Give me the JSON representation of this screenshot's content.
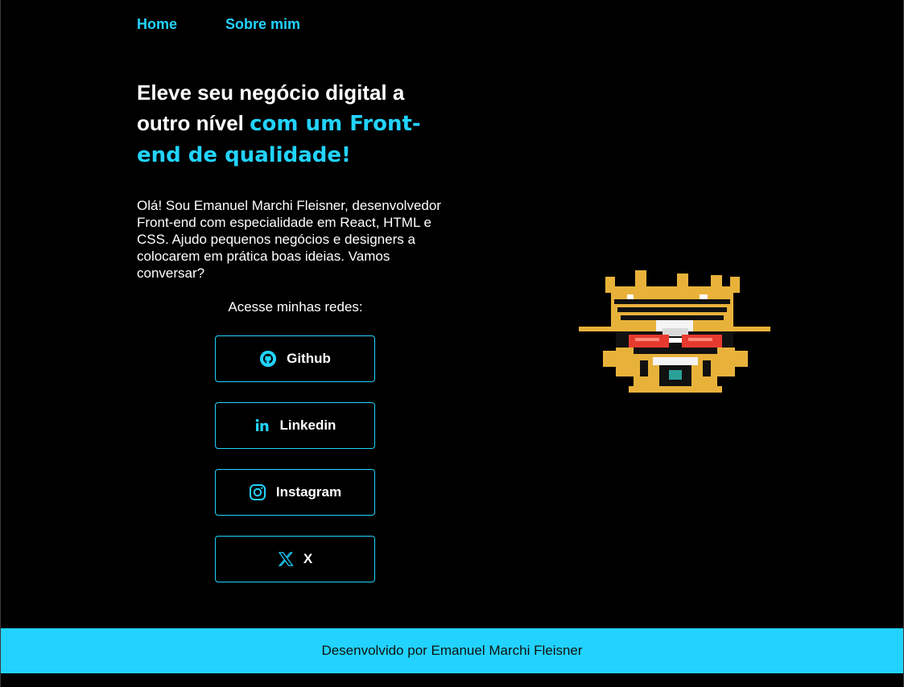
{
  "nav": {
    "home": "Home",
    "about": "Sobre mim"
  },
  "hero": {
    "title_plain": "Eleve seu negócio digital a outro nível",
    "title_accent": "com um Front-end de qualidade!",
    "intro": "Olá! Sou Emanuel Marchi Fleisner, desenvolvedor Front-end com especialidade em React, HTML e CSS. Ajudo pequenos negócios e designers a colocarem em prática boas ideias. Vamos conversar?"
  },
  "socials": {
    "label": "Acesse minhas redes:",
    "items": [
      {
        "label": "Github",
        "icon": "github-icon"
      },
      {
        "label": "Linkedin",
        "icon": "linkedin-icon"
      },
      {
        "label": "Instagram",
        "icon": "instagram-icon"
      },
      {
        "label": "X",
        "icon": "x-icon"
      }
    ]
  },
  "avatar": {
    "icon": "pixel-art-avatar"
  },
  "footer": {
    "text": "Desenvolvido por Emanuel Marchi Fleisner"
  },
  "colors": {
    "background": "#000000",
    "accent": "#22d3ff",
    "text": "#ffffff",
    "footer_text": "#111111"
  }
}
